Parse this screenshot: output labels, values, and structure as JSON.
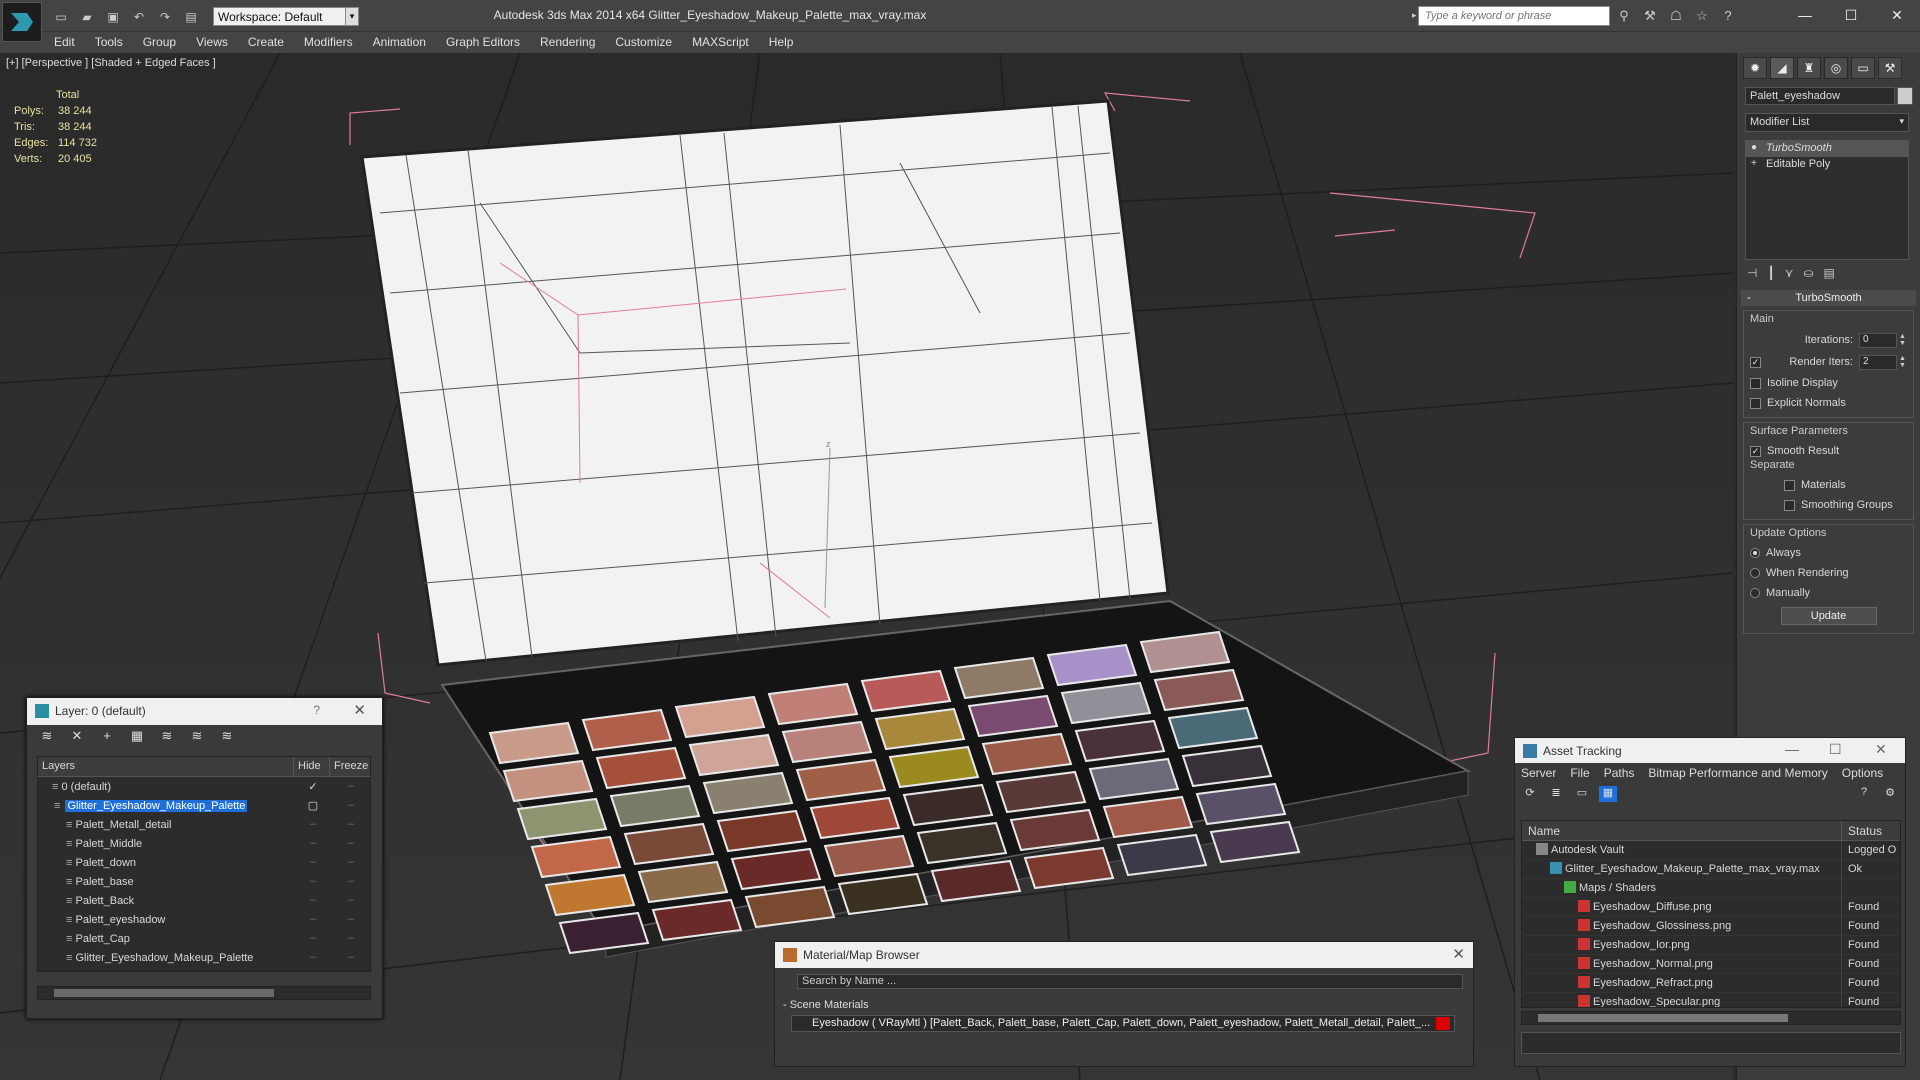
{
  "window": {
    "title": "Autodesk 3ds Max  2014 x64      Glitter_Eyeshadow_Makeup_Palette_max_vray.max",
    "workspace": "Workspace: Default",
    "search_placeholder": "Type a keyword or phrase"
  },
  "menu": [
    "Edit",
    "Tools",
    "Group",
    "Views",
    "Create",
    "Modifiers",
    "Animation",
    "Graph Editors",
    "Rendering",
    "Customize",
    "MAXScript",
    "Help"
  ],
  "viewport": {
    "label": "[+] [Perspective ] [Shaded + Edged Faces ]",
    "stats_header": "Total",
    "stats": [
      {
        "k": "Polys:",
        "v": "38 244"
      },
      {
        "k": "Tris:",
        "v": "38 244"
      },
      {
        "k": "Edges:",
        "v": "114 732"
      },
      {
        "k": "Verts:",
        "v": "20 405"
      }
    ]
  },
  "command_panel": {
    "object_name": "Palett_eyeshadow",
    "modifier_list": "Modifier List",
    "stack": [
      "TurboSmooth",
      "Editable Poly"
    ],
    "rollout": "TurboSmooth",
    "main_label": "Main",
    "iterations_label": "Iterations:",
    "iterations": "0",
    "render_iters_label": "Render Iters:",
    "render_iters": "2",
    "isoline": "Isoline Display",
    "explicit": "Explicit Normals",
    "surface_params": "Surface Parameters",
    "smooth_result": "Smooth Result",
    "separate": "Separate",
    "materials": "Materials",
    "smoothing_groups": "Smoothing Groups",
    "update_options": "Update Options",
    "always": "Always",
    "when_rendering": "When Rendering",
    "manually": "Manually",
    "update_btn": "Update"
  },
  "layer_window": {
    "title": "Layer: 0 (default)",
    "help": "?",
    "col_layers": "Layers",
    "col_hide": "Hide",
    "col_freeze": "Freeze",
    "rows": [
      {
        "name": "0 (default)",
        "indent": 0
      },
      {
        "name": "Glitter_Eyeshadow_Makeup_Palette",
        "indent": 0
      },
      {
        "name": "Palett_Metall_detail",
        "indent": 1
      },
      {
        "name": "Palett_Middle",
        "indent": 1
      },
      {
        "name": "Palett_down",
        "indent": 1
      },
      {
        "name": "Palett_base",
        "indent": 1
      },
      {
        "name": "Palett_Back",
        "indent": 1
      },
      {
        "name": "Palett_eyeshadow",
        "indent": 1
      },
      {
        "name": "Palett_Cap",
        "indent": 1
      },
      {
        "name": "Glitter_Eyeshadow_Makeup_Palette",
        "indent": 1
      }
    ]
  },
  "material_browser": {
    "title": "Material/Map Browser",
    "search": "Search by Name ...",
    "scene_materials": "- Scene Materials",
    "row": "Eyeshadow  ( VRayMtl ) [Palett_Back, Palett_base, Palett_Cap, Palett_down, Palett_eyeshadow, Palett_Metall_detail, Palett_..."
  },
  "asset_tracking": {
    "title": "Asset Tracking",
    "menu": [
      "Server",
      "File",
      "Paths",
      "Bitmap Performance and Memory",
      "Options"
    ],
    "col_name": "Name",
    "col_status": "Status",
    "rows": [
      {
        "name": "Autodesk Vault",
        "status": "Logged O",
        "indent": 1
      },
      {
        "name": "Glitter_Eyeshadow_Makeup_Palette_max_vray.max",
        "status": "Ok",
        "indent": 2
      },
      {
        "name": "Maps / Shaders",
        "status": "",
        "indent": 3
      },
      {
        "name": "Eyeshadow_Diffuse.png",
        "status": "Found",
        "indent": 4
      },
      {
        "name": "Eyeshadow_Glossiness.png",
        "status": "Found",
        "indent": 4
      },
      {
        "name": "Eyeshadow_Ior.png",
        "status": "Found",
        "indent": 4
      },
      {
        "name": "Eyeshadow_Normal.png",
        "status": "Found",
        "indent": 4
      },
      {
        "name": "Eyeshadow_Refract.png",
        "status": "Found",
        "indent": 4
      },
      {
        "name": "Eyeshadow_Specular.png",
        "status": "Found",
        "indent": 4
      }
    ]
  },
  "colors": {
    "selection": "#1e6fd9",
    "stats": "#e8e0a0",
    "bbox": "#e07aa0"
  }
}
